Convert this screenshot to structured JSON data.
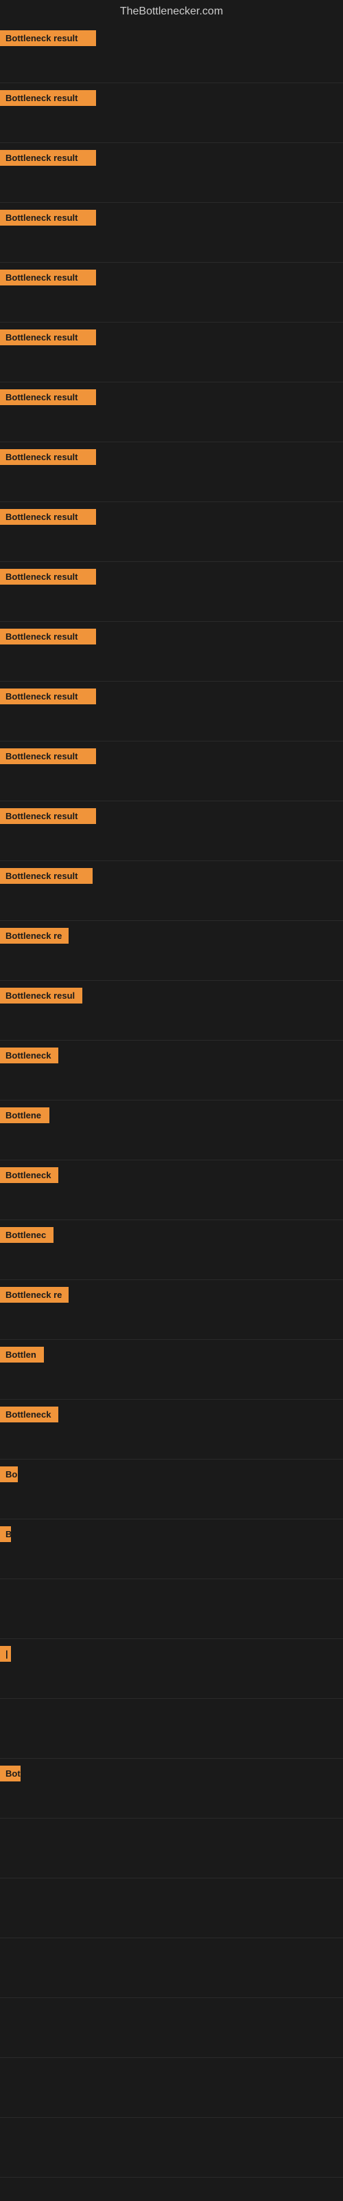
{
  "site": {
    "title": "TheBottlenecker.com"
  },
  "bars": [
    {
      "id": 1,
      "label": "Bottleneck result",
      "width": 140
    },
    {
      "id": 2,
      "label": "Bottleneck result",
      "width": 140
    },
    {
      "id": 3,
      "label": "Bottleneck result",
      "width": 140
    },
    {
      "id": 4,
      "label": "Bottleneck result",
      "width": 140
    },
    {
      "id": 5,
      "label": "Bottleneck result",
      "width": 140
    },
    {
      "id": 6,
      "label": "Bottleneck result",
      "width": 140
    },
    {
      "id": 7,
      "label": "Bottleneck result",
      "width": 140
    },
    {
      "id": 8,
      "label": "Bottleneck result",
      "width": 140
    },
    {
      "id": 9,
      "label": "Bottleneck result",
      "width": 140
    },
    {
      "id": 10,
      "label": "Bottleneck result",
      "width": 140
    },
    {
      "id": 11,
      "label": "Bottleneck result",
      "width": 140
    },
    {
      "id": 12,
      "label": "Bottleneck result",
      "width": 140
    },
    {
      "id": 13,
      "label": "Bottleneck result",
      "width": 140
    },
    {
      "id": 14,
      "label": "Bottleneck result",
      "width": 140
    },
    {
      "id": 15,
      "label": "Bottleneck result",
      "width": 135
    },
    {
      "id": 16,
      "label": "Bottleneck re",
      "width": 100
    },
    {
      "id": 17,
      "label": "Bottleneck resul",
      "width": 120
    },
    {
      "id": 18,
      "label": "Bottleneck",
      "width": 85
    },
    {
      "id": 19,
      "label": "Bottlene",
      "width": 72
    },
    {
      "id": 20,
      "label": "Bottleneck",
      "width": 85
    },
    {
      "id": 21,
      "label": "Bottlenec",
      "width": 78
    },
    {
      "id": 22,
      "label": "Bottleneck re",
      "width": 100
    },
    {
      "id": 23,
      "label": "Bottlen",
      "width": 64
    },
    {
      "id": 24,
      "label": "Bottleneck",
      "width": 85
    },
    {
      "id": 25,
      "label": "Bo",
      "width": 26
    },
    {
      "id": 26,
      "label": "B",
      "width": 14
    },
    {
      "id": 27,
      "label": "",
      "width": 0
    },
    {
      "id": 28,
      "label": "|",
      "width": 8
    },
    {
      "id": 29,
      "label": "",
      "width": 0
    },
    {
      "id": 30,
      "label": "Bot",
      "width": 30
    },
    {
      "id": 31,
      "label": "",
      "width": 0
    },
    {
      "id": 32,
      "label": "",
      "width": 0
    },
    {
      "id": 33,
      "label": "",
      "width": 0
    },
    {
      "id": 34,
      "label": "",
      "width": 0
    },
    {
      "id": 35,
      "label": "",
      "width": 0
    },
    {
      "id": 36,
      "label": "",
      "width": 0
    }
  ]
}
